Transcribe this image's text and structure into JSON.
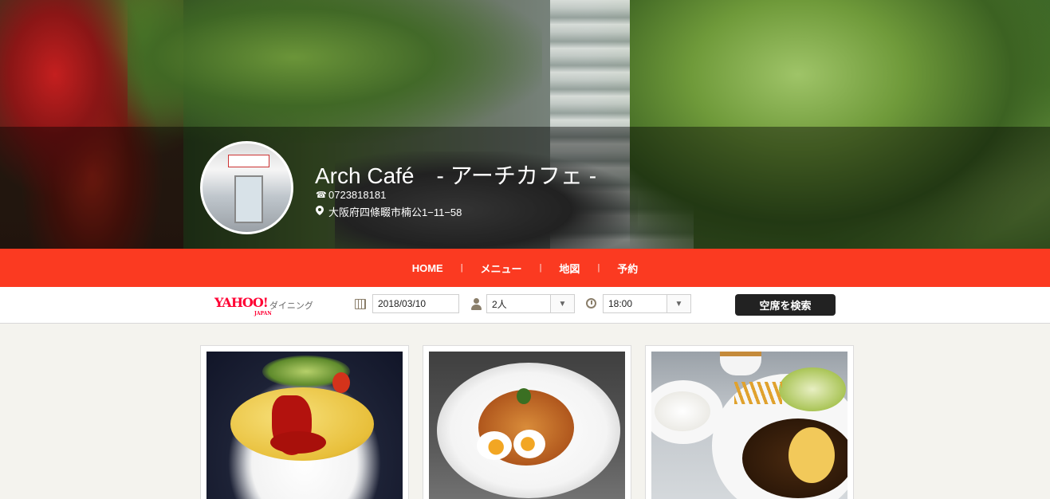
{
  "header": {
    "title": "Arch Café　- アーチカフェ -",
    "phone": "0723818181",
    "address": "大阪府四條畷市楠公1−11−58",
    "phone_icon": "phone-icon",
    "address_icon": "map-pin-icon"
  },
  "nav": {
    "items": [
      "HOME",
      "メニュー",
      "地図",
      "予約"
    ],
    "separator": "|",
    "color": "#fb3a21"
  },
  "reservation": {
    "logo_text": "YAHOO!",
    "logo_sub": "JAPAN",
    "logo_service": "ダイニング",
    "date": "2018/03/10",
    "people": "2人",
    "time": "18:00",
    "search_button": "空席を検索",
    "dropdown_arrow": "▼"
  },
  "gallery": {
    "items": [
      {
        "name": "omurice"
      },
      {
        "name": "pasta"
      },
      {
        "name": "hamburg"
      }
    ]
  },
  "colors": {
    "accent": "#fb3a21",
    "yahoo_red": "#ff0033",
    "button_dark": "#222222",
    "page_bg": "#f4f3ee"
  }
}
